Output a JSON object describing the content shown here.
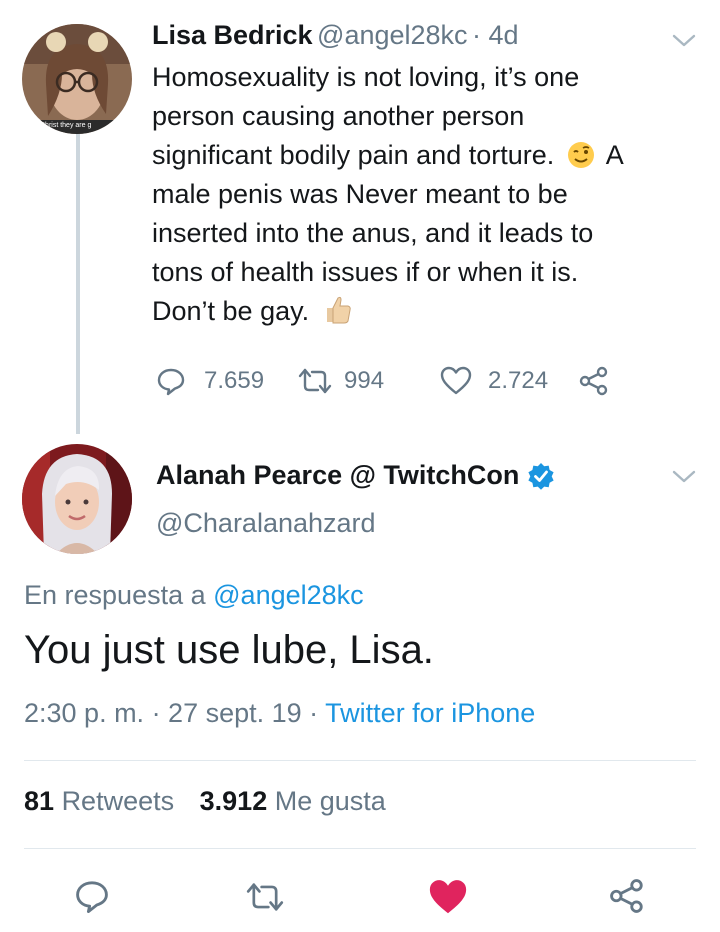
{
  "parent_tweet": {
    "display_name": "Lisa Bedrick",
    "handle": "@angel28kc",
    "age": "· 4d",
    "avatar_caption": "Christ they are g",
    "text_lines": [
      "Homosexuality is not loving, it’s one",
      "person causing another person",
      "significant bodily pain and torture.",
      "male penis was Never meant to be",
      "inserted into the anus, and it leads to",
      "tons of health issues if or when it is.",
      "Don’t be gay."
    ],
    "wink_suffix": "A",
    "replies": "7.659",
    "retweets": "994",
    "likes": "2.724"
  },
  "main_tweet": {
    "display_name": "Alanah Pearce @ TwitchCon",
    "handle": "@Charalanahzard",
    "reply_prefix": "En respuesta a",
    "reply_to": "@angel28kc",
    "text": "You just use lube, Lisa.",
    "time": "2:30 p. m. · 27 sept. 19 ·",
    "source": "Twitter for iPhone",
    "retweet_count": "81",
    "retweet_label": "Retweets",
    "like_count": "3.912",
    "like_label": "Me gusta"
  },
  "colors": {
    "accent": "#1b95e0",
    "like_active": "#e0245e",
    "muted": "#657786"
  }
}
